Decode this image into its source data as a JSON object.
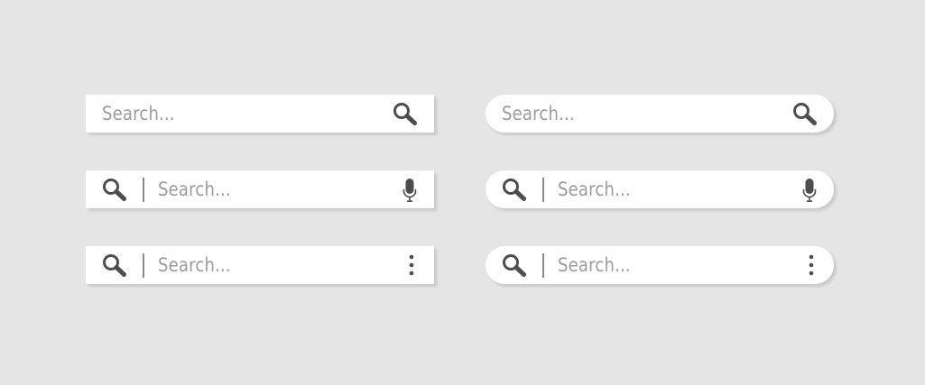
{
  "colors": {
    "background": "#e5e5e5",
    "bar": "#ffffff",
    "placeholder": "#9c9c9c",
    "icon": "#4d4d4d",
    "divider": "#8a8a8a"
  },
  "search_bars": [
    {
      "style": "square",
      "layout": "text-then-search-icon",
      "placeholder": "Search..."
    },
    {
      "style": "rounded",
      "layout": "text-then-search-icon",
      "placeholder": "Search..."
    },
    {
      "style": "square",
      "layout": "search-icon-divider-text-mic",
      "placeholder": "Search..."
    },
    {
      "style": "rounded",
      "layout": "search-icon-divider-text-mic",
      "placeholder": "Search..."
    },
    {
      "style": "square",
      "layout": "search-icon-divider-text-menu",
      "placeholder": "Search..."
    },
    {
      "style": "rounded",
      "layout": "search-icon-divider-text-menu",
      "placeholder": "Search..."
    }
  ],
  "icons": {
    "search": "search-icon",
    "mic": "microphone-icon",
    "menu": "more-vertical-icon"
  }
}
